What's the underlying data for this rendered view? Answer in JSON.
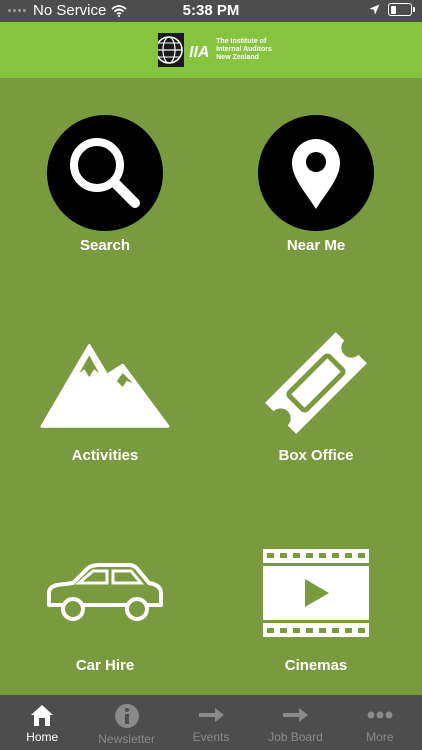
{
  "status": {
    "carrier": "No Service",
    "time": "5:38 PM"
  },
  "header": {
    "logo_mark": "IIA",
    "logo_lines": [
      "The Institute of",
      "Internal Auditors",
      "New Zealand"
    ]
  },
  "tiles": [
    {
      "label": "Search",
      "icon": "search-icon"
    },
    {
      "label": "Near Me",
      "icon": "map-pin-icon"
    },
    {
      "label": "Activities",
      "icon": "mountain-icon"
    },
    {
      "label": "Box Office",
      "icon": "ticket-icon"
    },
    {
      "label": "Car Hire",
      "icon": "car-icon"
    },
    {
      "label": "Cinemas",
      "icon": "film-icon"
    }
  ],
  "tabs": [
    {
      "label": "Home",
      "icon": "home-icon",
      "active": true
    },
    {
      "label": "Newsletter",
      "icon": "info-icon",
      "active": false
    },
    {
      "label": "Events",
      "icon": "arrow-right-icon",
      "active": false
    },
    {
      "label": "Job Board",
      "icon": "arrow-right-icon",
      "active": false
    },
    {
      "label": "More",
      "icon": "more-icon",
      "active": false
    }
  ],
  "colors": {
    "background": "#7a9a3f",
    "header": "#86c440",
    "status_bar": "#4d4d4d",
    "tab_bar": "#4d4d4d",
    "tab_inactive": "#8a8a8a",
    "tab_active": "#ffffff"
  }
}
